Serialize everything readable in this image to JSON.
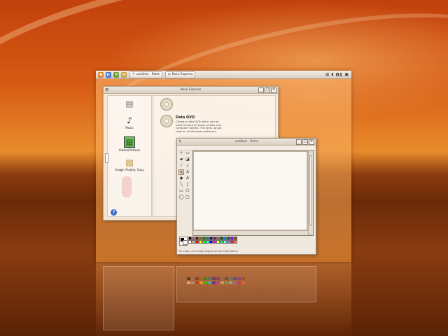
{
  "panel": {
    "tasks": [
      {
        "label": "untitled - Paint"
      },
      {
        "label": "Nero Express"
      }
    ],
    "clock": "01"
  },
  "nero": {
    "title": "Nero Express",
    "sidebar": [
      {
        "label": "",
        "icon": "document-icon"
      },
      {
        "label": "Music",
        "icon": "music-note-icon"
      },
      {
        "label": "Videos/Pictures",
        "icon": "film-icon"
      },
      {
        "label": "Image, Project, Copy",
        "icon": "folder-image-icon"
      }
    ],
    "options": [
      {
        "title": "",
        "desc": ""
      },
      {
        "title": "Data DVD",
        "desc": "Create a data DVD which can be used to store all types of files and computer folders. The DVD can be read on all Windows platforms."
      }
    ],
    "help_label": "?"
  },
  "paint": {
    "title": "untitled - Paint",
    "status": "For Help, click Help Topics on the Help Menu.",
    "colors": [
      "#000000",
      "#808080",
      "#800000",
      "#808000",
      "#008000",
      "#008080",
      "#000080",
      "#800080",
      "#808040",
      "#004040",
      "#0080ff",
      "#004080",
      "#8000ff",
      "#804000",
      "#ffffff",
      "#c0c0c0",
      "#ff0000",
      "#ffff00",
      "#00ff00",
      "#00ffff",
      "#0000ff",
      "#ff00ff",
      "#ffff80",
      "#00ff80",
      "#80ffff",
      "#8080ff",
      "#ff0080",
      "#ff8040"
    ]
  }
}
